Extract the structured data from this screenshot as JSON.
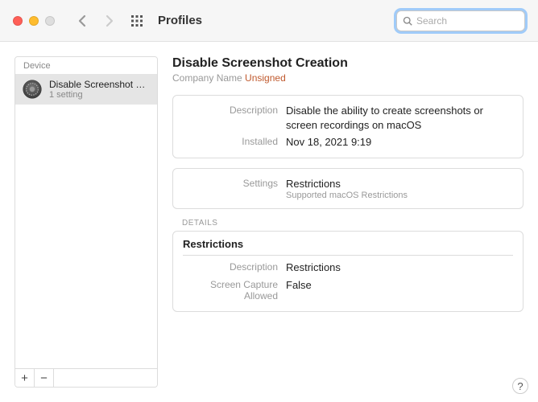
{
  "toolbar": {
    "title": "Profiles",
    "search_placeholder": "Search"
  },
  "sidebar": {
    "header": "Device",
    "items": [
      {
        "name": "Disable Screenshot C...",
        "subtitle": "1 setting"
      }
    ],
    "add_label": "+",
    "remove_label": "−"
  },
  "main": {
    "title": "Disable Screenshot Creation",
    "company": "Company Name ",
    "signed_status": "Unsigned",
    "info": {
      "description_label": "Description",
      "description_value": "Disable the ability to create screenshots or screen recordings on macOS",
      "installed_label": "Installed",
      "installed_value": "Nov 18, 2021 9:19"
    },
    "settings": {
      "label": "Settings",
      "value": "Restrictions",
      "sub": "Supported macOS Restrictions"
    },
    "details": {
      "header": "DETAILS",
      "title": "Restrictions",
      "rows": [
        {
          "label": "Description",
          "value": "Restrictions"
        },
        {
          "label": "Screen Capture Allowed",
          "value": "False"
        }
      ]
    }
  },
  "help_label": "?"
}
